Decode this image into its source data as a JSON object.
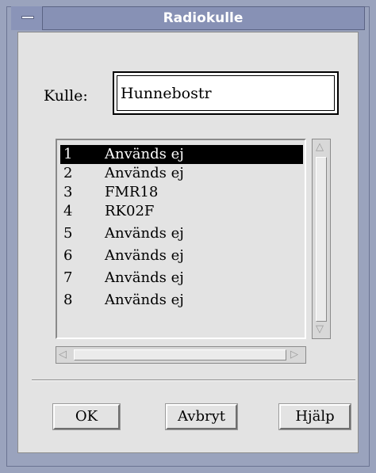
{
  "window": {
    "title": "Radiokulle"
  },
  "kulle": {
    "label": "Kulle:",
    "value": "Hunnebostr"
  },
  "list": {
    "items": [
      {
        "num": "1",
        "text": "Används ej",
        "selected": true
      },
      {
        "num": "2",
        "text": "Används ej"
      },
      {
        "num": "3",
        "text": "FMR18"
      },
      {
        "num": "4",
        "text": "RK02F"
      },
      {
        "num": "5",
        "text": "Används ej"
      },
      {
        "num": "6",
        "text": "Används ej"
      },
      {
        "num": "7",
        "text": "Används ej"
      },
      {
        "num": "8",
        "text": "Används ej"
      }
    ]
  },
  "buttons": {
    "ok": "OK",
    "cancel": "Avbryt",
    "help": "Hjälp"
  },
  "colors": {
    "title_bar": "#8791b5",
    "dialog_bg": "#e3e3e3",
    "selection": "#000000"
  }
}
